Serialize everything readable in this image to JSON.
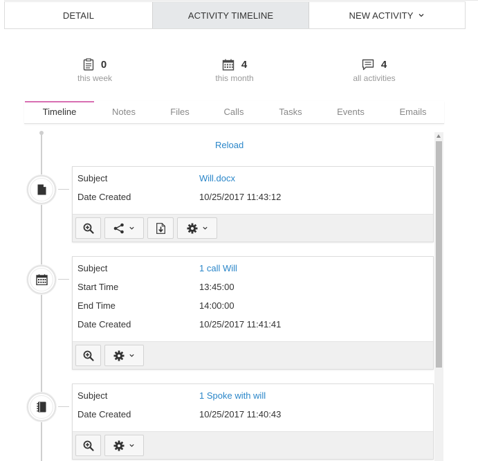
{
  "top_tabs": [
    {
      "label": "DETAIL"
    },
    {
      "label": "ACTIVITY TIMELINE"
    },
    {
      "label": "NEW ACTIVITY"
    }
  ],
  "stats": [
    {
      "value": "0",
      "label": "this week",
      "icon": "clipboard-icon"
    },
    {
      "value": "4",
      "label": "this month",
      "icon": "calendar-icon"
    },
    {
      "value": "4",
      "label": "all activities",
      "icon": "comment-icon"
    }
  ],
  "sub_tabs": [
    "Timeline",
    "Notes",
    "Files",
    "Calls",
    "Tasks",
    "Events",
    "Emails"
  ],
  "active_sub_tab": "Timeline",
  "reload_label": "Reload",
  "timeline": [
    {
      "icon": "file-icon",
      "fields": [
        {
          "label": "Subject",
          "value": "Will.docx",
          "link": true
        },
        {
          "label": "Date Created",
          "value": "10/25/2017 11:43:12"
        }
      ],
      "actions": [
        "zoom-in-icon",
        "share-icon",
        "download-icon",
        "gear-icon"
      ]
    },
    {
      "icon": "calendar-icon",
      "fields": [
        {
          "label": "Subject",
          "value": "1 call Will",
          "link": true
        },
        {
          "label": "Start Time",
          "value": "13:45:00"
        },
        {
          "label": "End Time",
          "value": "14:00:00"
        },
        {
          "label": "Date Created",
          "value": "10/25/2017 11:41:41"
        }
      ],
      "actions": [
        "zoom-in-icon",
        "gear-icon"
      ]
    },
    {
      "icon": "notebook-icon",
      "fields": [
        {
          "label": "Subject",
          "value": "1 Spoke with will",
          "link": true
        },
        {
          "label": "Date Created",
          "value": "10/25/2017 11:40:43"
        }
      ],
      "actions": [
        "zoom-in-icon",
        "gear-icon"
      ]
    }
  ],
  "colors": {
    "link": "#2a86c9",
    "active_tab_accent": "#d86fb2",
    "active_top_tab_bg": "#e6e8ea"
  }
}
